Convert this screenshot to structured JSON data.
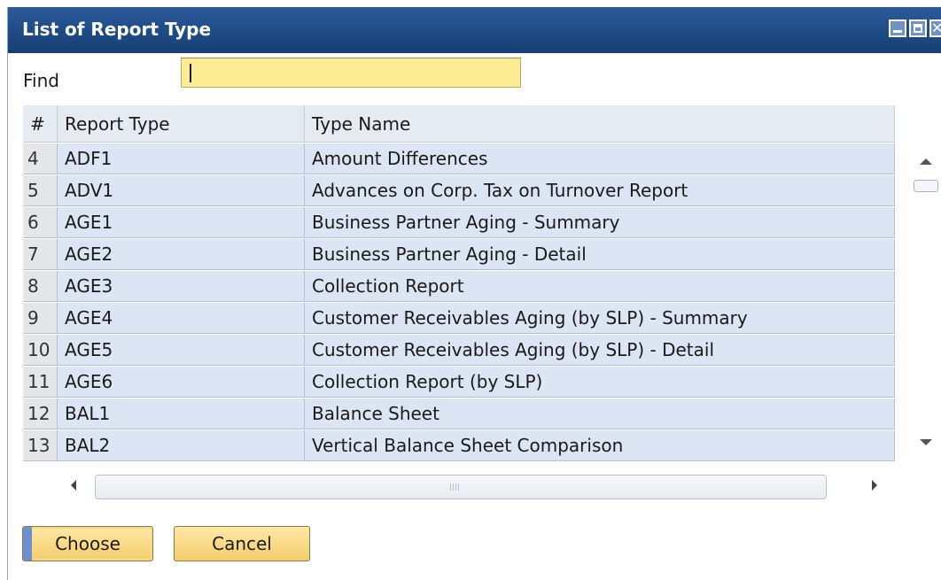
{
  "window": {
    "title": "List of Report Type"
  },
  "find": {
    "label": "Find",
    "value": ""
  },
  "columns": {
    "num": "#",
    "report_type": "Report Type",
    "type_name": "Type Name"
  },
  "rows": [
    {
      "num": "4",
      "report_type": "ADF1",
      "type_name": "Amount Differences"
    },
    {
      "num": "5",
      "report_type": "ADV1",
      "type_name": "Advances on Corp. Tax on Turnover Report"
    },
    {
      "num": "6",
      "report_type": "AGE1",
      "type_name": "Business Partner Aging - Summary"
    },
    {
      "num": "7",
      "report_type": "AGE2",
      "type_name": "Business Partner Aging - Detail"
    },
    {
      "num": "8",
      "report_type": "AGE3",
      "type_name": "Collection Report"
    },
    {
      "num": "9",
      "report_type": "AGE4",
      "type_name": "Customer Receivables Aging (by SLP) - Summary"
    },
    {
      "num": "10",
      "report_type": "AGE5",
      "type_name": "Customer Receivables Aging (by SLP) - Detail"
    },
    {
      "num": "11",
      "report_type": "AGE6",
      "type_name": "Collection Report (by SLP)"
    },
    {
      "num": "12",
      "report_type": "BAL1",
      "type_name": "Balance Sheet"
    },
    {
      "num": "13",
      "report_type": "BAL2",
      "type_name": "Vertical Balance Sheet Comparison"
    }
  ],
  "buttons": {
    "choose": "Choose",
    "cancel": "Cancel"
  },
  "icons": {
    "minimize": "minimize-icon",
    "maximize": "maximize-icon",
    "close": "close-icon",
    "sort": "sort-ascending-icon",
    "scroll_up": "scroll-up-icon",
    "scroll_down": "scroll-down-icon",
    "scroll_left": "scroll-left-icon",
    "scroll_right": "scroll-right-icon"
  },
  "colors": {
    "titlebar": "#1f4c86",
    "find_field": "#fdec93",
    "row_bg": "#dbe5f4",
    "button": "#f4cc6b"
  }
}
